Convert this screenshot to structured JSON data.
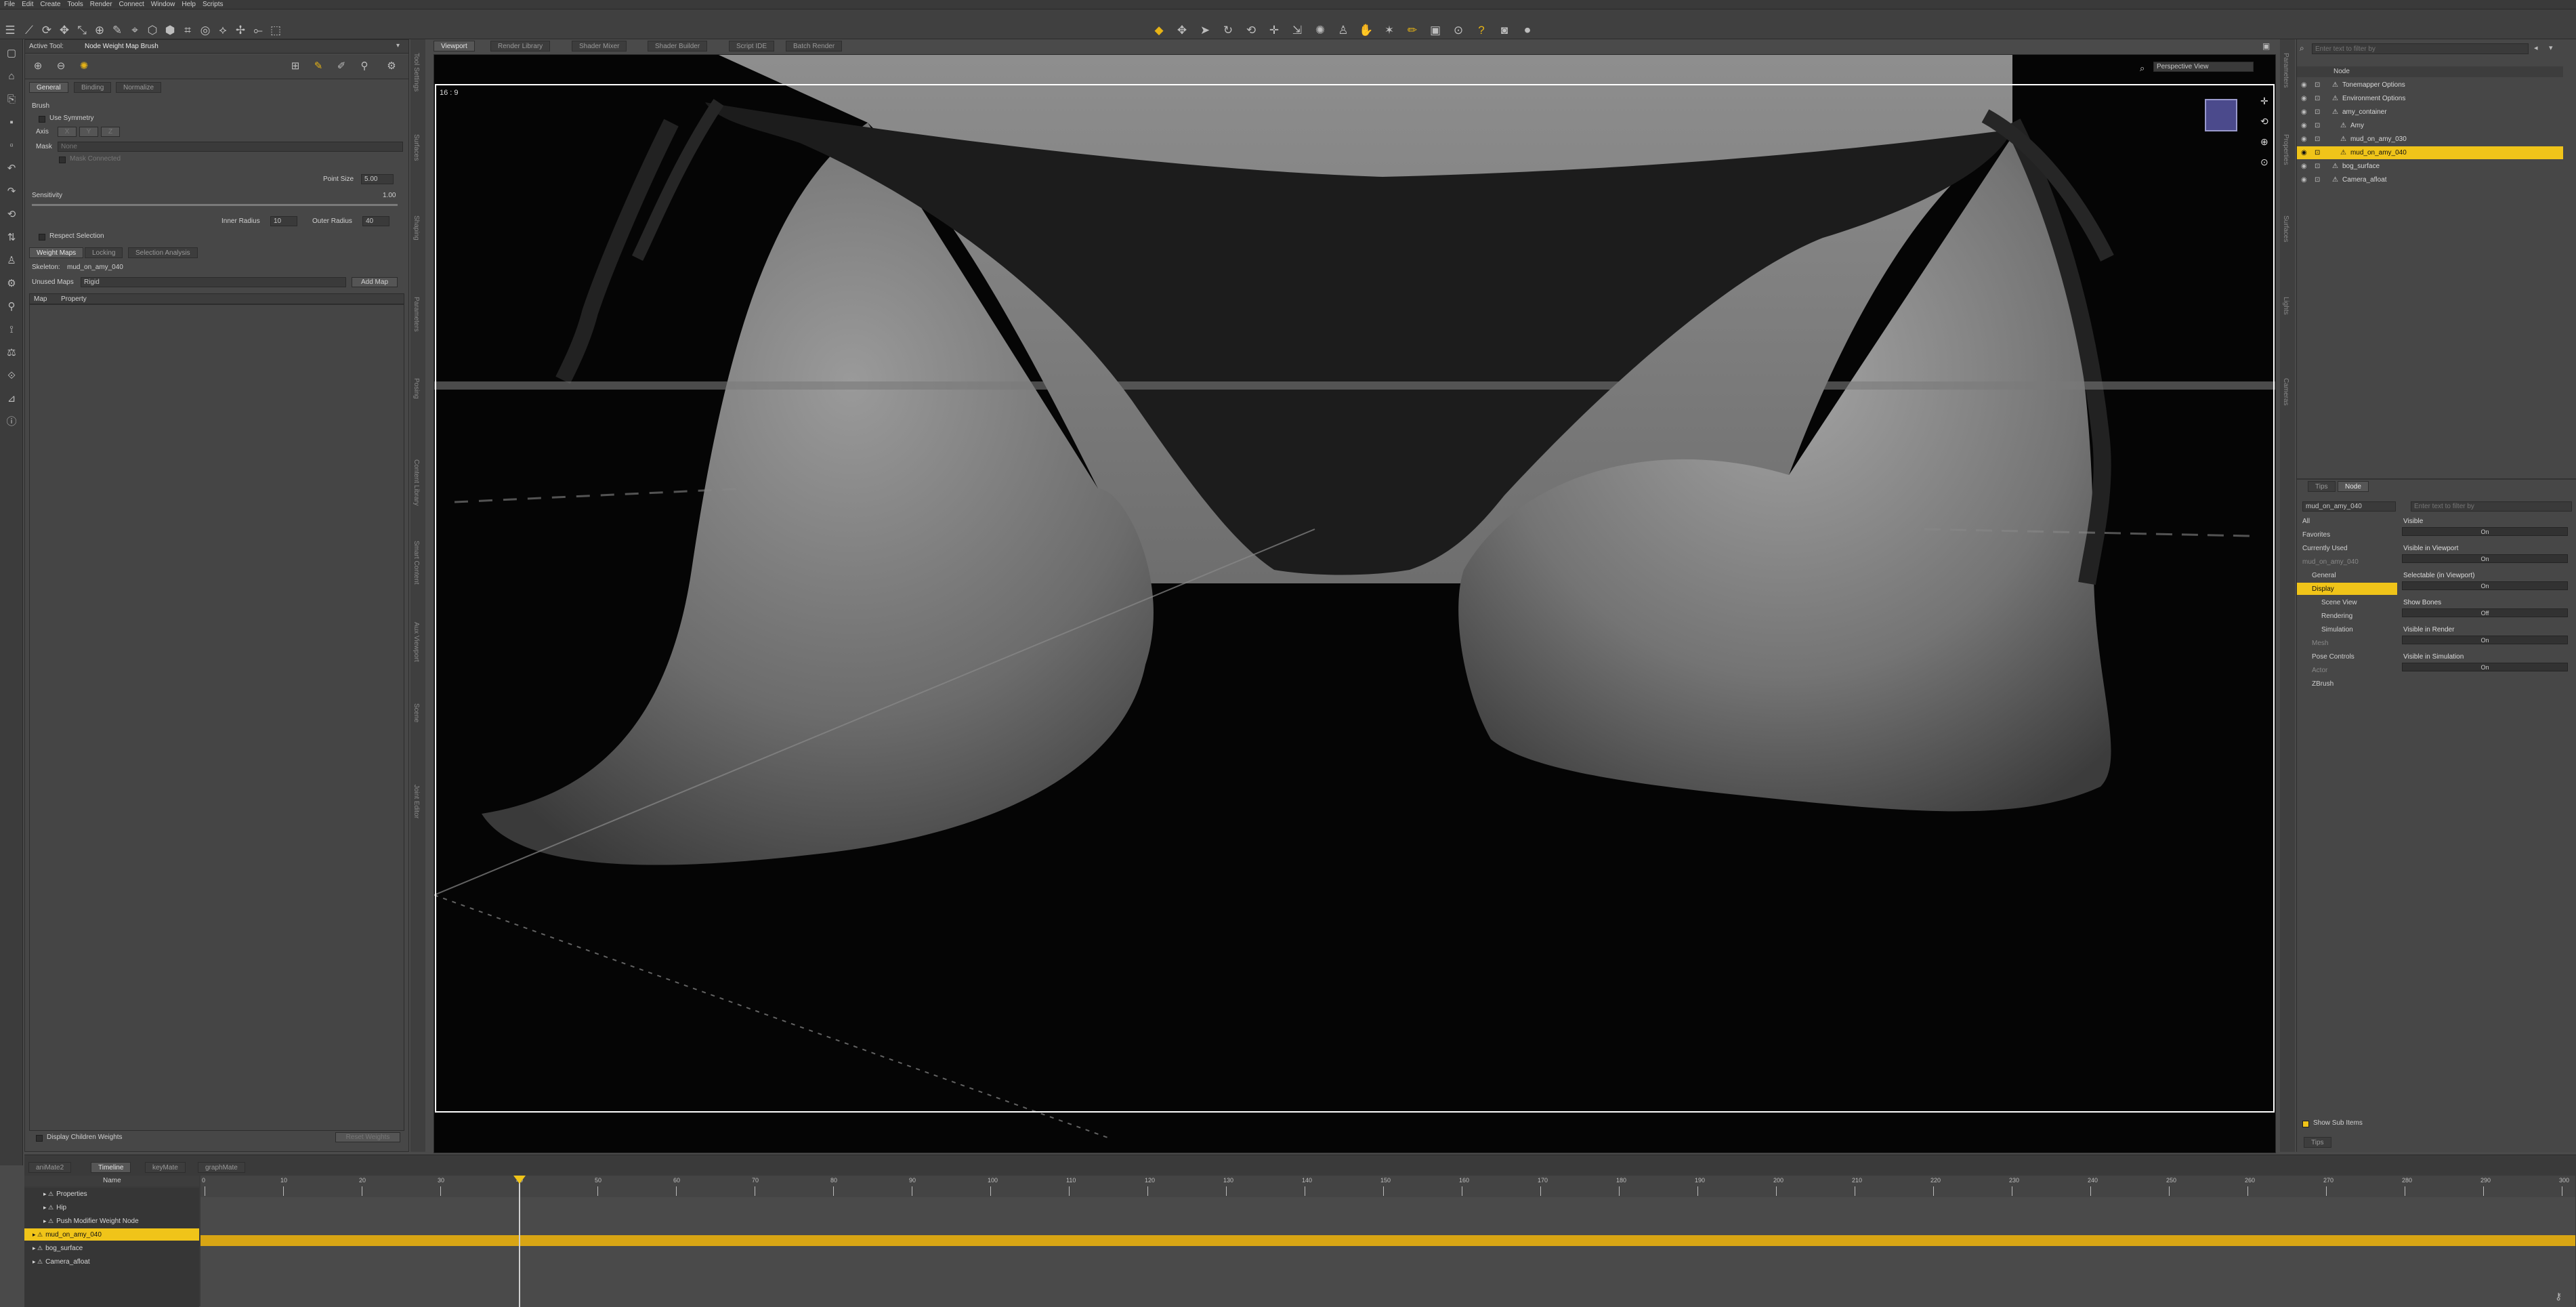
{
  "menu": [
    "File",
    "Edit",
    "Create",
    "Tools",
    "Render",
    "Connect",
    "Window",
    "Help",
    "Scripts"
  ],
  "active_tool": {
    "label": "Active Tool:",
    "name": "Node Weight Map Brush"
  },
  "left_panel": {
    "tabs": [
      "General",
      "Binding",
      "Normalize"
    ],
    "brush_label": "Brush",
    "use_symmetry": "Use Symmetry",
    "axis_label": "Axis",
    "axis_opts": [
      "X",
      "Y",
      "Z"
    ],
    "mask_label": "Mask",
    "mask_value": "None",
    "mask_connected": "Mask Connected",
    "point_size_label": "Point Size",
    "point_size_value": "5.00",
    "sensitivity_label": "Sensitivity",
    "sensitivity_value": "1.00",
    "inner_radius_label": "Inner Radius",
    "inner_radius_value": "10",
    "outer_radius_label": "Outer Radius",
    "outer_radius_value": "40",
    "respect_selection": "Respect Selection",
    "bottom_tabs": [
      "Weight Maps",
      "Locking",
      "Selection Analysis"
    ],
    "skeleton_label": "Skeleton:",
    "skeleton_value": "mud_on_amy_040",
    "unused_maps_label": "Unused Maps",
    "unused_maps_value": "Rigid",
    "add_map": "Add Map",
    "grid_cols": [
      "Map",
      "Property"
    ],
    "display_children": "Display Children Weights",
    "reset_btn": "Reset Weights"
  },
  "left_vtabs": [
    "Tool Settings",
    "Surfaces",
    "Shaping",
    "Parameters",
    "Posing",
    "Content Library",
    "Smart Content",
    "Aux Viewport",
    "Scene",
    "Joint Editor"
  ],
  "viewport": {
    "tabs": [
      "Viewport",
      "Render Library",
      "Shader Mixer",
      "Shader Builder",
      "Script IDE",
      "Batch Render"
    ],
    "ratio": "16 : 9",
    "view_name": "Perspective View"
  },
  "scene": {
    "filter_placeholder": "Enter text to filter by",
    "header": "Node",
    "items": [
      {
        "name": "Tonemapper Options",
        "indent": 1
      },
      {
        "name": "Environment Options",
        "indent": 1
      },
      {
        "name": "amy_container",
        "indent": 1
      },
      {
        "name": "Amy",
        "indent": 2
      },
      {
        "name": "mud_on_amy_030",
        "indent": 2
      },
      {
        "name": "mud_on_amy_040",
        "indent": 2,
        "selected": true
      },
      {
        "name": "bog_surface",
        "indent": 1
      },
      {
        "name": "Camera_afloat",
        "indent": 1
      }
    ]
  },
  "params": {
    "tabs": [
      "Tips",
      "Node"
    ],
    "node_select": "mud_on_amy_040",
    "filter_placeholder": "Enter text to filter by",
    "tree": [
      {
        "name": "All",
        "indent": 0
      },
      {
        "name": "Favorites",
        "indent": 0
      },
      {
        "name": "Currently Used",
        "indent": 0
      },
      {
        "name": "mud_on_amy_040",
        "indent": 0,
        "dim": true
      },
      {
        "name": "General",
        "indent": 1
      },
      {
        "name": "Display",
        "indent": 1,
        "selected": true
      },
      {
        "name": "Scene View",
        "indent": 2
      },
      {
        "name": "Rendering",
        "indent": 2
      },
      {
        "name": "Simulation",
        "indent": 2
      },
      {
        "name": "Mesh",
        "indent": 1,
        "dim": true
      },
      {
        "name": "Pose Controls",
        "indent": 1
      },
      {
        "name": "Actor",
        "indent": 1,
        "dim": true
      },
      {
        "name": "ZBrush",
        "indent": 1
      }
    ],
    "props": [
      {
        "label": "Visible",
        "value": "On"
      },
      {
        "label": "Visible in Viewport",
        "value": "On"
      },
      {
        "label": "Selectable (in Viewport)",
        "value": "On"
      },
      {
        "label": "Show Bones",
        "value": "Off"
      },
      {
        "label": "Visible in Render",
        "value": "On"
      },
      {
        "label": "Visible in Simulation",
        "value": "On"
      }
    ],
    "show_sub_items": "Show Sub Items",
    "tips": "Tips"
  },
  "right_vtabs": [
    "Parameters",
    "Properties",
    "Surfaces",
    "Lights",
    "Cameras"
  ],
  "timeline": {
    "tabs": [
      "aniMate2",
      "Timeline",
      "keyMate",
      "graphMate"
    ],
    "name_header": "Name",
    "rows": [
      {
        "name": "Properties",
        "indent": 1
      },
      {
        "name": "Hip",
        "indent": 1
      },
      {
        "name": "Push Modifier Weight Node",
        "indent": 1
      },
      {
        "name": "mud_on_amy_040",
        "indent": 0,
        "selected": true
      },
      {
        "name": "bog_surface",
        "indent": 0
      },
      {
        "name": "Camera_afloat",
        "indent": 0
      }
    ],
    "ticks": [
      "0",
      "10",
      "20",
      "30",
      "40",
      "50",
      "60",
      "70",
      "80",
      "90",
      "100",
      "110",
      "120",
      "130",
      "140",
      "150",
      "160",
      "170",
      "180",
      "190",
      "200",
      "210",
      "220",
      "230",
      "240",
      "250",
      "260",
      "270",
      "280",
      "290",
      "300"
    ],
    "current_frame": 40
  },
  "colors": {
    "accent": "#f0c419",
    "panel": "#474747",
    "viewport": "#000000"
  }
}
